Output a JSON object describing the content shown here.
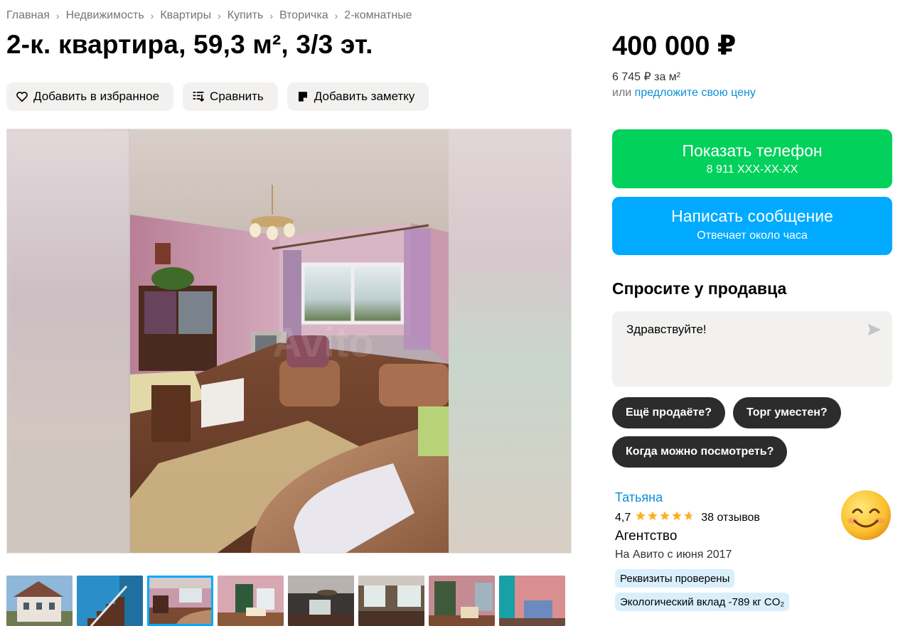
{
  "breadcrumb": [
    "Главная",
    "Недвижимость",
    "Квартиры",
    "Купить",
    "Вторичка",
    "2-комнатные"
  ],
  "breadcrumb_separator": "›",
  "title": "2-к. квартира, 59,3 м², 3/3 эт.",
  "actions": {
    "favorite": "Добавить в избранное",
    "compare": "Сравнить",
    "note": "Добавить заметку"
  },
  "photo": {
    "watermark": "Avito"
  },
  "price": {
    "value": "400 000 ₽",
    "per_meter": "6 745 ₽ за м²",
    "offer_prefix": "или",
    "offer_link": "предложите свою цену"
  },
  "phone_button": {
    "label": "Показать телефон",
    "number": "8 911 XXX-XX-XX"
  },
  "message_button": {
    "label": "Написать сообщение",
    "sub": "Отвечает около часа"
  },
  "ask": {
    "title": "Спросите у продавца",
    "message": "Здравствуйте!",
    "chips": [
      "Ещё продаёте?",
      "Торг уместен?",
      "Когда можно посмотреть?"
    ]
  },
  "seller": {
    "name": "Татьяна",
    "rating": "4,7",
    "rating_value": 4.7,
    "reviews": "38 отзывов",
    "type": "Агентство",
    "since": "На Авито с июня 2017",
    "badges": [
      "Реквизиты проверены",
      "Экологический вклад -789 кг CO₂"
    ]
  },
  "thumbnails": [
    "house-exterior",
    "staircase",
    "living-room",
    "kitchen-room",
    "ceiling-lamp-room",
    "window-room",
    "wardrobe-room",
    "teal-door-room"
  ],
  "active_thumbnail": 2,
  "colors": {
    "green": "#02d15c",
    "blue": "#00aaff",
    "link": "#0a8fd8",
    "chip": "#2c2c2c",
    "badge": "#d9f0fc",
    "star": "#ffb021"
  }
}
